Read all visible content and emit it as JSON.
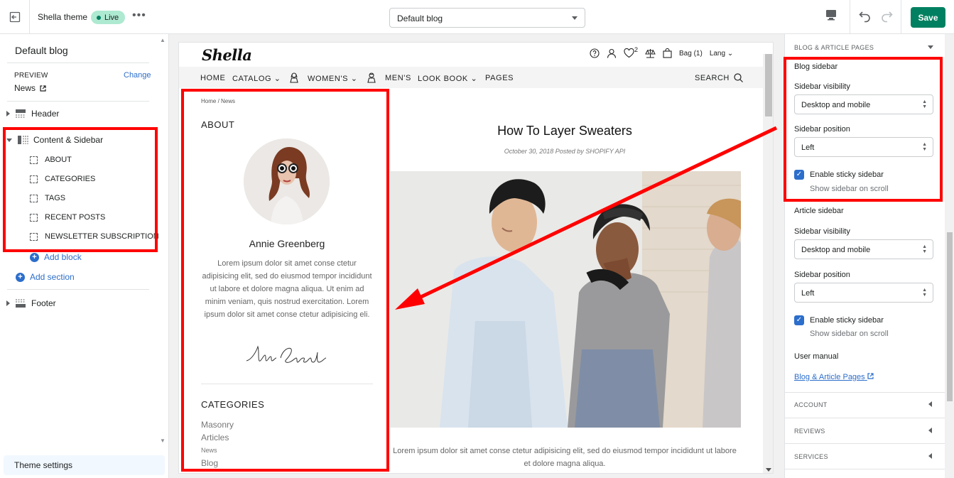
{
  "topbar": {
    "theme_name": "Shella theme",
    "live_badge": "Live",
    "page_select_value": "Default blog",
    "save_label": "Save"
  },
  "left_sidebar": {
    "title": "Default blog",
    "preview_label": "PREVIEW",
    "change_label": "Change",
    "preview_value": "News",
    "sections": [
      {
        "label": "Header"
      },
      {
        "label": "Content & Sidebar"
      },
      {
        "label": "Footer"
      }
    ],
    "blocks": [
      {
        "label": "ABOUT"
      },
      {
        "label": "CATEGORIES"
      },
      {
        "label": "TAGS"
      },
      {
        "label": "RECENT POSTS"
      },
      {
        "label": "NEWSLETTER SUBSCRIPTION"
      }
    ],
    "add_block": "Add block",
    "add_section": "Add section",
    "theme_settings": "Theme settings"
  },
  "store": {
    "logo": "Shella",
    "wishlist_count": "2",
    "bag_label": "Bag (1)",
    "lang_label": "Lang",
    "nav": [
      {
        "label": "HOME"
      },
      {
        "label": "CATALOG"
      },
      {
        "label": "WOMEN'S"
      },
      {
        "label": "MEN'S"
      },
      {
        "label": "LOOK BOOK"
      },
      {
        "label": "PAGES"
      }
    ],
    "search_label": "SEARCH",
    "breadcrumb": "Home  /  News",
    "about_heading": "ABOUT",
    "author_name": "Annie Greenberg",
    "bio": "Lorem ipsum dolor sit amet conse ctetur adipisicing elit, sed do eiusmod tempor incididunt ut labore et dolore magna aliqua. Ut enim ad minim veniam, quis nostrud exercitation. Lorem ipsum dolor sit amet conse ctetur adipisicing eli.",
    "signature": "Annie Greenberg",
    "categories_heading": "CATEGORIES",
    "categories": [
      {
        "label": "Masonry"
      },
      {
        "label": "Articles"
      },
      {
        "label": "News"
      },
      {
        "label": "Blog"
      }
    ],
    "post_title": "How To Layer Sweaters",
    "post_meta": "October 30, 2018 Posted by SHOPIFY API",
    "post_excerpt": "Lorem ipsum dolor sit amet conse ctetur adipisicing elit, sed do eiusmod tempor incididunt ut labore et dolore magna aliqua."
  },
  "right_panel": {
    "section_title": "BLOG & ARTICLE PAGES",
    "blog_sidebar_heading": "Blog sidebar",
    "article_sidebar_heading": "Article sidebar",
    "visibility_label": "Sidebar visibility",
    "visibility_value": "Desktop and mobile",
    "position_label": "Sidebar position",
    "position_value": "Left",
    "sticky_label": "Enable sticky sidebar",
    "sticky_help": "Show sidebar on scroll",
    "user_manual_heading": "User manual",
    "user_manual_link": "Blog & Article Pages",
    "collapsed_sections": [
      {
        "label": "ACCOUNT"
      },
      {
        "label": "REVIEWS"
      },
      {
        "label": "SERVICES"
      }
    ]
  },
  "colors": {
    "annotation": "#ff0000",
    "save_button": "#008060",
    "link": "#2c6ecb",
    "live_badge": "#aee9d1"
  },
  "icons": [
    "exit-icon",
    "more-icon",
    "desktop-icon",
    "undo-icon",
    "redo-icon",
    "help-icon",
    "user-icon",
    "heart-icon",
    "compare-icon",
    "bag-icon",
    "search-icon",
    "external-link-icon",
    "checkbox-check-icon"
  ]
}
